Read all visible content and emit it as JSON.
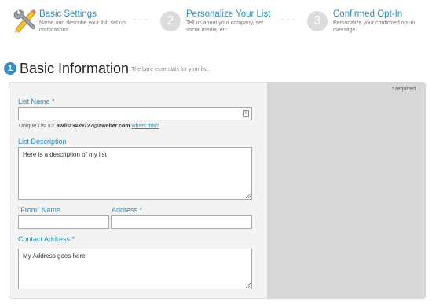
{
  "steps": [
    {
      "number": "",
      "title": "Basic Settings",
      "desc": "Name and describe your list, set up notifications.",
      "icon": "tools-icon"
    },
    {
      "number": "2",
      "title": "Personalize Your List",
      "desc": "Tell us about your company, set social media, etc."
    },
    {
      "number": "3",
      "title": "Confirmed Opt-In",
      "desc": "Personalize your confirmed opt-in message."
    }
  ],
  "section": {
    "number": "1",
    "title": "Basic Information",
    "subtitle": "The bare essentials for your list."
  },
  "form": {
    "required_note": "* required",
    "list_name": {
      "label": "List Name *",
      "value": ""
    },
    "unique_id": {
      "prefix": "Unique List ID:",
      "value": "awlist3439727@aweber.com",
      "link": "whats this?"
    },
    "list_description": {
      "label": "List Description",
      "value": "Here is a description of my list"
    },
    "from_name": {
      "label": "\"From\" Name",
      "value": ""
    },
    "address": {
      "label": "Address *",
      "value": ""
    },
    "contact_address": {
      "label": "Contact Address *",
      "value": "My Address goes here"
    }
  },
  "colors": {
    "accent": "#2a8fc0",
    "badge": "#3b8cc3",
    "side_panel": "#d8d8d8",
    "form_panel": "#f3f3f3"
  }
}
